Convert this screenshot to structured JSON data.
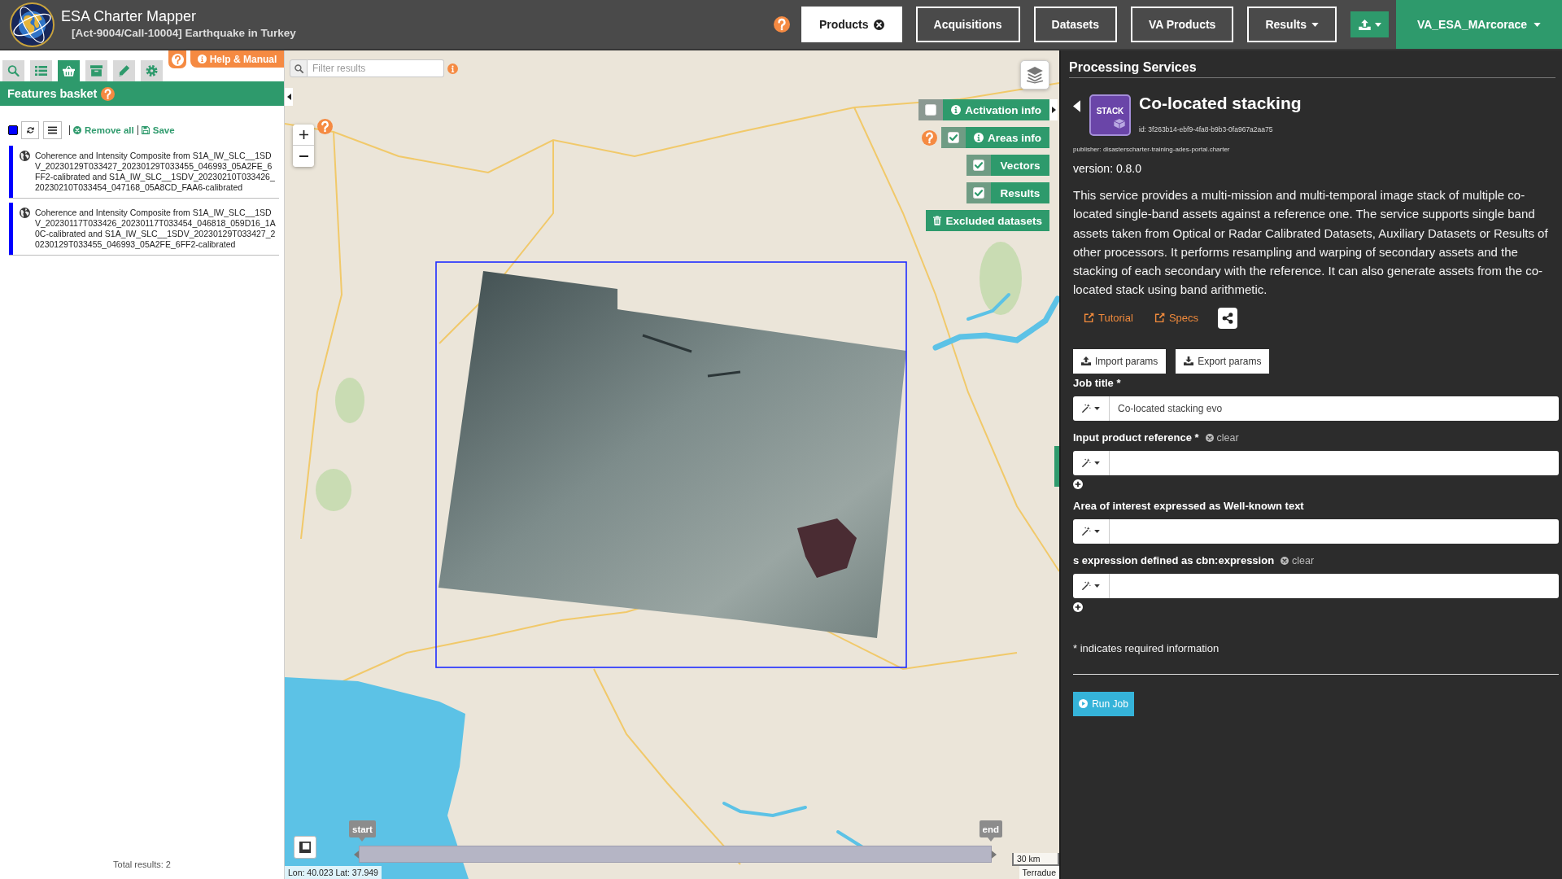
{
  "header": {
    "title": "ESA Charter Mapper",
    "subtitle": "[Act-9004/Call-10004] Earthquake in Turkey"
  },
  "nav": {
    "items": [
      {
        "label": "Products",
        "selected": true,
        "closable": true,
        "has_menu": false
      },
      {
        "label": "Acquisitions",
        "selected": false,
        "closable": false,
        "has_menu": false
      },
      {
        "label": "Datasets",
        "selected": false,
        "closable": false,
        "has_menu": false
      },
      {
        "label": "VA Products",
        "selected": false,
        "closable": false,
        "has_menu": false
      },
      {
        "label": "Results",
        "selected": false,
        "closable": false,
        "has_menu": true
      }
    ],
    "user": "VA_ESA_MArcorace"
  },
  "left_panel": {
    "tools": [
      {
        "kind": "search",
        "selected": false
      },
      {
        "kind": "list",
        "selected": false
      },
      {
        "kind": "basket",
        "selected": true
      },
      {
        "kind": "archive",
        "selected": false
      },
      {
        "kind": "edit",
        "selected": false
      },
      {
        "kind": "settings",
        "selected": false
      }
    ],
    "help_button": "Help & Manual",
    "basket": {
      "title": "Features basket",
      "remove_all": "Remove all",
      "save": "Save",
      "items": [
        {
          "text": "Coherence and Intensity Composite from S1A_IW_SLC__1SDV_20230129T033427_20230129T033455_046993_05A2FE_6FF2-calibrated and S1A_IW_SLC__1SDV_20230210T033426_20230210T033454_047168_05A8CD_FAA6-calibrated",
          "color": "#0000ff"
        },
        {
          "text": "Coherence and Intensity Composite from S1A_IW_SLC__1SDV_20230117T033426_20230117T033454_046818_059D16_1A0C-calibrated and S1A_IW_SLC__1SDV_20230129T033427_20230129T033455_046993_05A2FE_6FF2-calibrated",
          "color": "#0000ff"
        }
      ],
      "total": "Total results: 2"
    }
  },
  "map": {
    "filter": {
      "placeholder": "Filter results"
    },
    "layers": [
      {
        "label": "Activation info",
        "checked": false,
        "info": true,
        "help": false
      },
      {
        "label": "Areas info",
        "checked": true,
        "info": true,
        "help": true
      },
      {
        "label": "Vectors",
        "checked": true,
        "info": false,
        "help": false
      },
      {
        "label": "Results",
        "checked": true,
        "info": false,
        "help": false
      }
    ],
    "excluded_button": "Excluded datasets",
    "timeline": {
      "start": "start",
      "end": "end"
    },
    "scale": "30 km",
    "coordinates": "Lon: 40.023 Lat: 37.949",
    "attribution": "Terradue"
  },
  "panel": {
    "heading": "Processing Services",
    "service": {
      "badge": "STACK",
      "title": "Co-located stacking",
      "id": "id: 3f263b14-ebf9-4fa8-b9b3-0fa967a2aa75",
      "publisher": "publisher: disasterscharter-training-ades-portal.charter",
      "version": "version: 0.8.0",
      "description": "This service provides a multi-mission and multi-temporal image stack of multiple co-located single-band assets against a reference one. The service supports single band assets taken from Optical or Radar Calibrated Datasets, Auxiliary Datasets or Results of other processors. It performs resampling and warping of secondary assets and the stacking of each secondary with the reference. It can also generate assets from the co-located stack using band arithmetic.",
      "links": [
        "Tutorial",
        "Specs"
      ]
    },
    "param_buttons": [
      {
        "label": "Import params",
        "kind": "import"
      },
      {
        "label": "Export params",
        "kind": "export"
      }
    ],
    "fields": [
      {
        "label": "Job title *",
        "value": "Co-located stacking evo",
        "multi": false
      },
      {
        "label": "Input product reference *",
        "clear": "clear",
        "multi": true
      },
      {
        "label": "Area of interest expressed as Well-known text",
        "multi": false
      },
      {
        "label": "s expression defined as cbn:expression",
        "clear": "clear",
        "multi": true
      }
    ],
    "required_note": "* indicates required information",
    "run_button": "Run Job"
  }
}
